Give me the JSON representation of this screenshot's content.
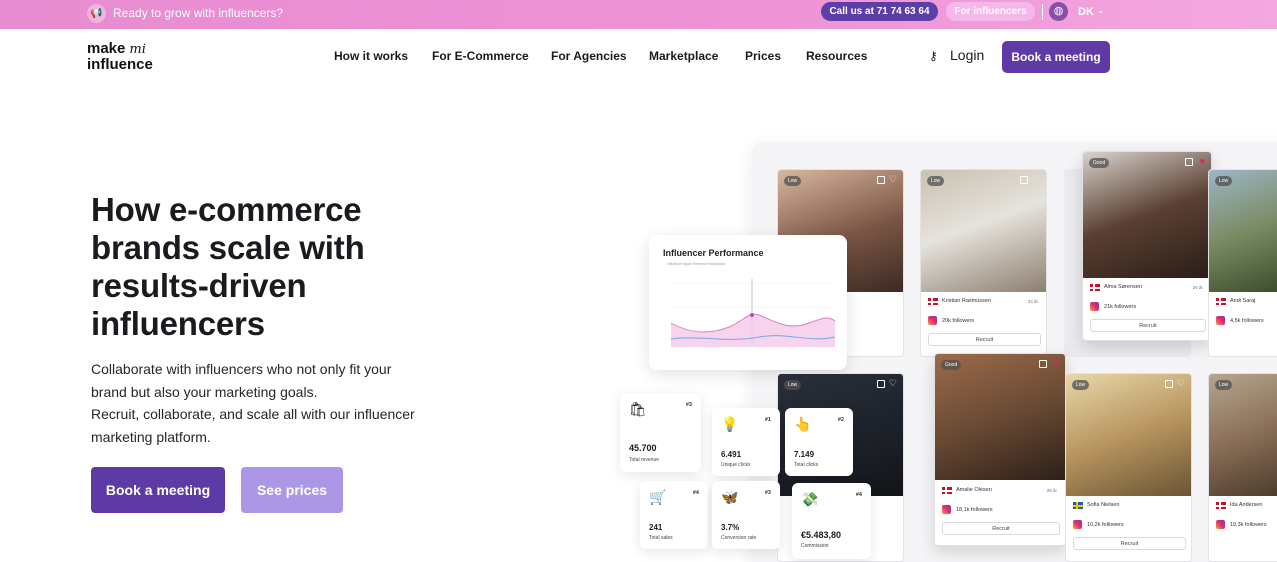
{
  "topbar": {
    "promo_text": "Ready to grow with influencers?",
    "call_label": "Call us at 71 74 63 64",
    "influencers_label": "For influencers",
    "language": "DK",
    "colors": {
      "brand_purple": "#5e3aa6",
      "pink": "#ee93d6"
    }
  },
  "header": {
    "logo_line1": "make",
    "logo_line2": "influence",
    "nav": [
      "How it works",
      "For E-Commerce",
      "For Agencies",
      "Marketplace",
      "Prices",
      "Resources"
    ],
    "login_label": "Login",
    "book_label": "Book a meeting"
  },
  "hero": {
    "title": "How e-commerce brands scale with results-driven influencers",
    "subtitle_line1": "Collaborate with influencers who not only fit your brand but also your marketing goals.",
    "subtitle_line2": "Recruit, collaborate, and scale all with our influencer marketing platform.",
    "primary_button": "Book a meeting",
    "secondary_button": "See prices"
  },
  "showcase": {
    "performance_title": "Influencer Performance",
    "performance_legend": "Influencer figure   Revenue breakdown",
    "influencers": [
      {
        "name": "",
        "followers": "",
        "badge": "Low",
        "flag": "dk"
      },
      {
        "name": "Kristian Rasmussen",
        "followers": "20k followers",
        "badge": "Low",
        "flag": "dk",
        "meta": "33 år"
      },
      {
        "name": "Alma Sørensen",
        "followers": "21k followers",
        "badge": "Good",
        "flag": "dk",
        "meta": "26 år"
      },
      {
        "name": "Andi Saraj",
        "followers": "4,5k followers",
        "badge": "Low",
        "flag": "dk"
      },
      {
        "name": "Amalie Olesen",
        "followers": "18,1k followers",
        "badge": "Good",
        "flag": "dk",
        "meta": "28 år"
      },
      {
        "name": "Sofia Nielsen",
        "followers": "10,2k followers",
        "badge": "Low",
        "flag": "se"
      },
      {
        "name": "Ida Andersen",
        "followers": "19,3k followers",
        "badge": "Low",
        "flag": "dk"
      }
    ],
    "recruit_label": "Recruit",
    "stats": [
      {
        "rank": "#3",
        "value": "45.700",
        "label": "Total revenue",
        "icon": "shopping-bags-icon"
      },
      {
        "rank": "#1",
        "value": "6.491",
        "label": "Unique clicks",
        "icon": "lightbulb-icon"
      },
      {
        "rank": "#2",
        "value": "7.149",
        "label": "Total clicks",
        "icon": "pointer-hand-icon"
      },
      {
        "rank": "#4",
        "value": "241",
        "label": "Total sales",
        "icon": "cart-icon"
      },
      {
        "rank": "#3",
        "value": "3.7%",
        "label": "Conversion rate",
        "icon": "shuffle-icon"
      },
      {
        "rank": "#4",
        "value": "€5.483,80",
        "label": "Commission",
        "icon": "money-icon"
      }
    ]
  }
}
